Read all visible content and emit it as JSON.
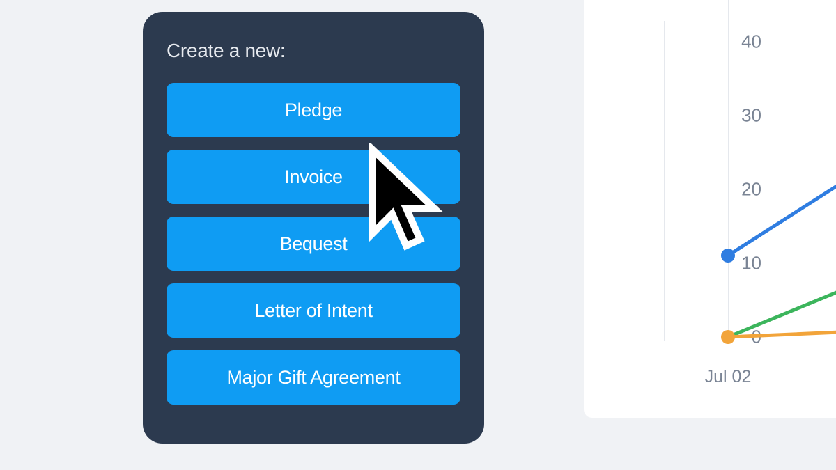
{
  "panel": {
    "title": "Create a new:",
    "buttons": [
      "Pledge",
      "Invoice",
      "Bequest",
      "Letter of Intent",
      "Major Gift Agreement"
    ]
  },
  "chart_data": {
    "type": "line",
    "y_ticks": [
      "40",
      "30",
      "20",
      "10",
      "0"
    ],
    "x_ticks": [
      "Jul 02"
    ],
    "ylim": [
      0,
      40
    ],
    "series": [
      {
        "name": "blue",
        "color": "#2f7de1",
        "points": [
          [
            0,
            11
          ]
        ]
      },
      {
        "name": "orange",
        "color": "#f2a43a",
        "points": [
          [
            0,
            0
          ]
        ]
      },
      {
        "name": "green",
        "color": "#3cb55c",
        "points": [
          [
            0,
            0
          ]
        ]
      }
    ]
  }
}
